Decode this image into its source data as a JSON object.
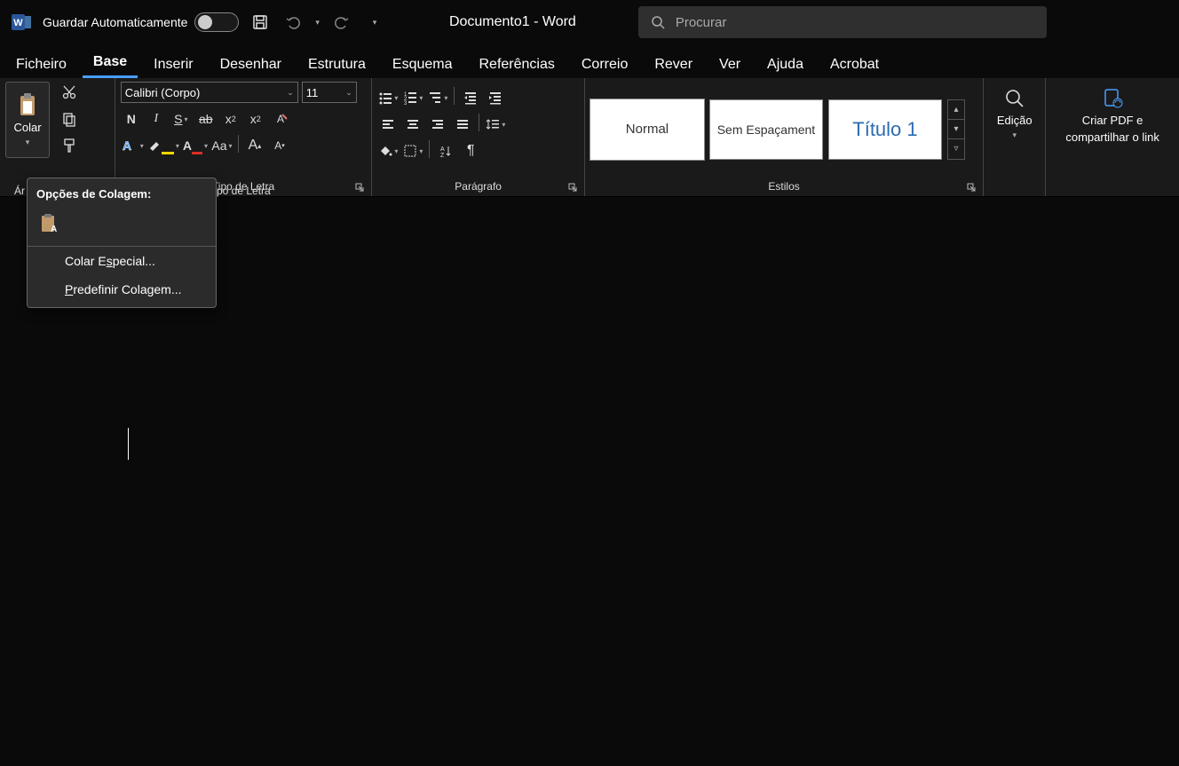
{
  "titlebar": {
    "autosave_label": "Guardar Automaticamente",
    "doc_title": "Documento1  -  Word",
    "search_placeholder": "Procurar"
  },
  "tabs": {
    "items": [
      {
        "label": "Ficheiro"
      },
      {
        "label": "Base"
      },
      {
        "label": "Inserir"
      },
      {
        "label": "Desenhar"
      },
      {
        "label": "Estrutura"
      },
      {
        "label": "Esquema"
      },
      {
        "label": "Referências"
      },
      {
        "label": "Correio"
      },
      {
        "label": "Rever"
      },
      {
        "label": "Ver"
      },
      {
        "label": "Ajuda"
      },
      {
        "label": "Acrobat"
      }
    ],
    "active_index": 1
  },
  "ribbon": {
    "clipboard": {
      "paste_label": "Colar",
      "group_truncated_label": "Área de Transferência"
    },
    "font": {
      "font_name": "Calibri (Corpo)",
      "font_size": "11",
      "group_label": "Tipo de Letra"
    },
    "paragraph": {
      "group_label": "Parágrafo"
    },
    "styles": {
      "items": [
        {
          "label": "Normal"
        },
        {
          "label": "Sem Espaçament"
        },
        {
          "label": "Título 1"
        }
      ],
      "group_label": "Estilos"
    },
    "editing": {
      "label": "Edição"
    },
    "pdf": {
      "line1": "Criar PDF e",
      "line2": "compartilhar o link"
    }
  },
  "context_menu": {
    "header": "Opções de Colagem:",
    "items": [
      {
        "prefix": "Colar E",
        "ul": "s",
        "suffix": "pecial..."
      },
      {
        "prefix": "",
        "ul": "P",
        "suffix": "redefinir Colagem..."
      }
    ]
  }
}
